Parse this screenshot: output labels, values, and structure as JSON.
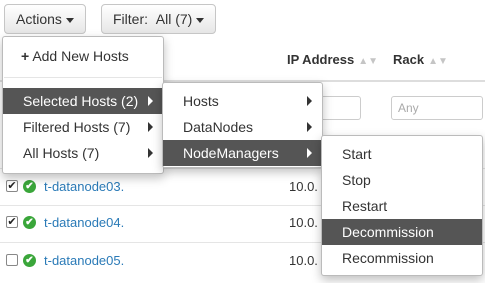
{
  "toolbar": {
    "actions_label": "Actions",
    "filter_label": "Filter:",
    "filter_value": "All (7)"
  },
  "table": {
    "headers": {
      "ip": "IP Address",
      "rack": "Rack"
    },
    "filters": {
      "rack_placeholder": "Any"
    },
    "rows": [
      {
        "host": "t-datanode03.",
        "ip": "10.0."
      },
      {
        "host": "t-datanode04.",
        "ip": "10.0."
      },
      {
        "host": "t-datanode05.",
        "ip": "10.0."
      }
    ]
  },
  "actions_menu": {
    "add": "Add New Hosts",
    "selected": "Selected Hosts (2)",
    "filtered": "Filtered Hosts (7)",
    "all": "All Hosts (7)"
  },
  "hosts_submenu": {
    "hosts": "Hosts",
    "datanodes": "DataNodes",
    "nodemanagers": "NodeManagers"
  },
  "nm_submenu": {
    "start": "Start",
    "stop": "Stop",
    "restart": "Restart",
    "decommission": "Decommission",
    "recommission": "Recommission"
  }
}
